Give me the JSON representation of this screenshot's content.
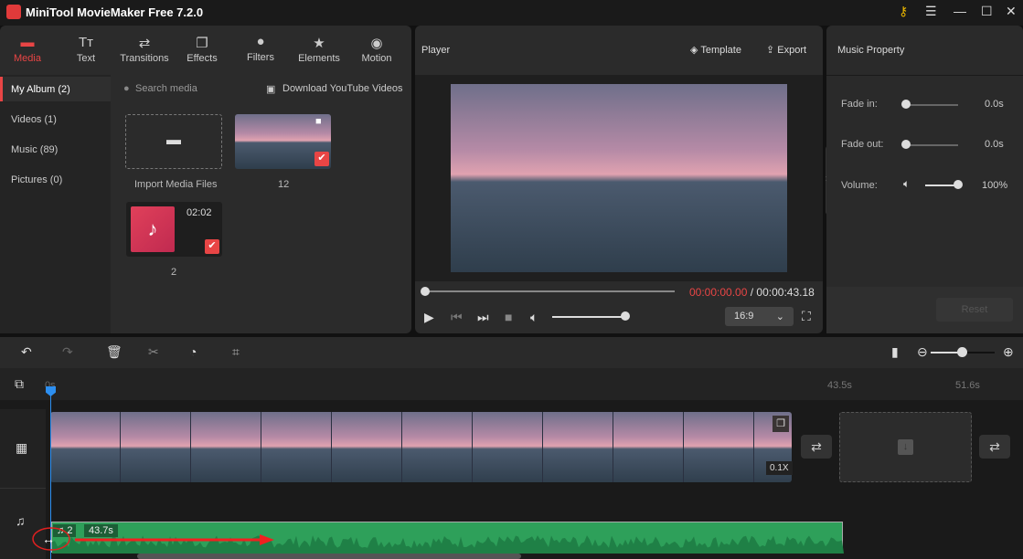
{
  "app": {
    "title": "MiniTool MovieMaker Free 7.2.0"
  },
  "toolbar": [
    {
      "label": "Media",
      "icon": "folder-icon"
    },
    {
      "label": "Text",
      "icon": "text-icon"
    },
    {
      "label": "Transitions",
      "icon": "transitions-icon"
    },
    {
      "label": "Effects",
      "icon": "effects-icon"
    },
    {
      "label": "Filters",
      "icon": "filters-icon"
    },
    {
      "label": "Elements",
      "icon": "elements-icon"
    },
    {
      "label": "Motion",
      "icon": "motion-icon"
    }
  ],
  "sidebar": [
    {
      "label": "My Album (2)"
    },
    {
      "label": "Videos (1)"
    },
    {
      "label": "Music (89)"
    },
    {
      "label": "Pictures (0)"
    }
  ],
  "media": {
    "search_placeholder": "Search media",
    "download": "Download YouTube Videos",
    "import": "Import Media Files",
    "items": [
      {
        "label": "12"
      },
      {
        "label": "2",
        "duration": "02:02"
      }
    ]
  },
  "player": {
    "title": "Player",
    "template": "Template",
    "export": "Export",
    "current": "00:00:00.00",
    "separator": " / ",
    "total": "00:00:43.18",
    "aspect": "16:9",
    "volume": 0.8,
    "accent": "#e84545"
  },
  "music_property": {
    "title": "Music Property",
    "fade_in_label": "Fade in:",
    "fade_in": "0.0s",
    "fade_out_label": "Fade out:",
    "fade_out": "0.0s",
    "volume_label": "Volume:",
    "volume": "100%",
    "reset": "Reset"
  },
  "timeline": {
    "ruler": [
      "0s",
      "43.5s",
      "51.6s"
    ],
    "speed": "0.1X",
    "audio_name": "2",
    "audio_duration": "43.7s",
    "audio_color": "#2ea05a"
  }
}
